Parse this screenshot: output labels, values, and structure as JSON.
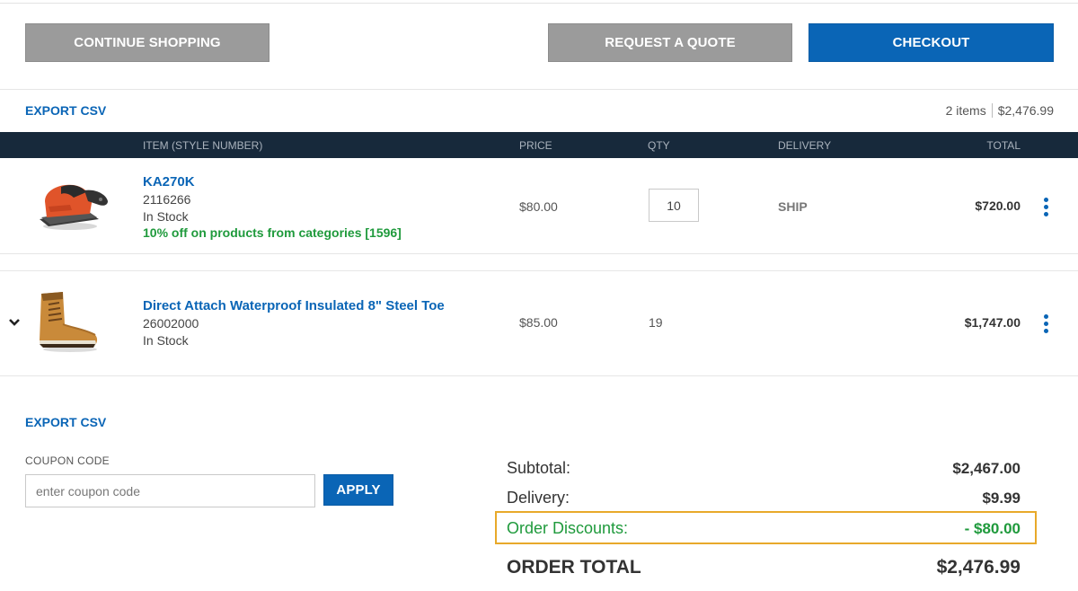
{
  "actions": {
    "continue_label": "CONTINUE SHOPPING",
    "quote_label": "REQUEST A QUOTE",
    "checkout_label": "CHECKOUT"
  },
  "cart_header": {
    "export_label": "EXPORT CSV",
    "item_count": "2 items",
    "summary_total": "$2,476.99"
  },
  "table": {
    "columns": {
      "item": "ITEM (STYLE NUMBER)",
      "price": "PRICE",
      "qty": "QTY",
      "delivery": "DELIVERY",
      "total": "TOTAL"
    },
    "rows": [
      {
        "name": "KA270K",
        "style_number": "2116266",
        "stock": "In Stock",
        "promo": "10% off on products from categories [1596]",
        "price": "$80.00",
        "qty": "10",
        "delivery": "SHIP",
        "total": "$720.00",
        "image_icon": "orbital-sander-icon"
      },
      {
        "name": "Direct Attach Waterproof Insulated 8\" Steel Toe",
        "style_number": "26002000",
        "stock": "In Stock",
        "price": "$85.00",
        "qty": "19",
        "total": "$1,747.00",
        "image_icon": "work-boot-icon"
      }
    ]
  },
  "footer": {
    "export_label": "EXPORT CSV",
    "coupon": {
      "label": "COUPON CODE",
      "placeholder": "enter coupon code",
      "value": "",
      "apply_label": "APPLY"
    }
  },
  "totals": {
    "subtotal_label": "Subtotal:",
    "subtotal_value": "$2,467.00",
    "delivery_label": "Delivery:",
    "delivery_value": "$9.99",
    "discount_label": "Order Discounts:",
    "discount_value": "- $80.00",
    "order_total_label": "ORDER TOTAL",
    "order_total_value": "$2,476.99"
  },
  "colors": {
    "brand_blue": "#0a65b6",
    "header_navy": "#17293b",
    "button_grey": "#9b9b9b",
    "discount_green": "#1f9a3c",
    "highlight_orange": "#e8a92a"
  }
}
